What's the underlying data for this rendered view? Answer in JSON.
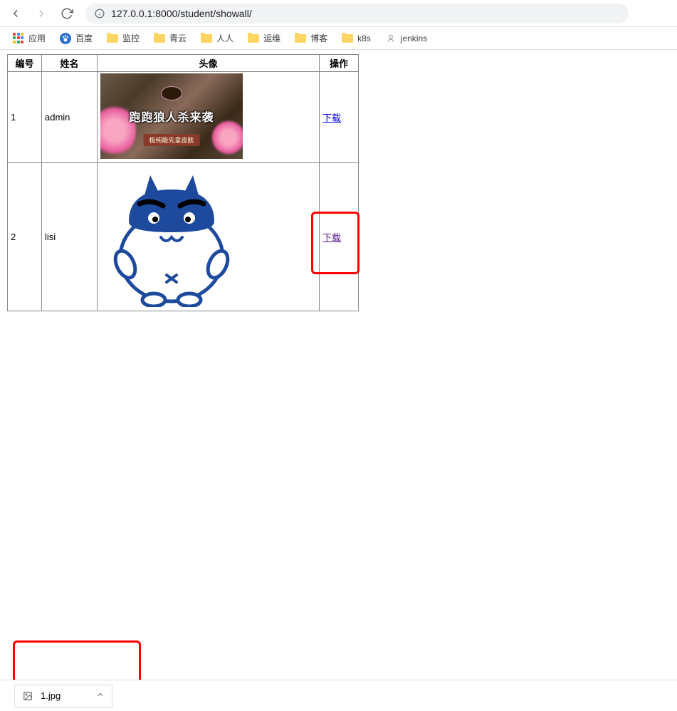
{
  "toolbar": {
    "url": "127.0.0.1:8000/student/showall/"
  },
  "bookmarks": {
    "apps": "应用",
    "baidu": "百度",
    "items": [
      {
        "label": "监控"
      },
      {
        "label": "青云"
      },
      {
        "label": "人人"
      },
      {
        "label": "运维"
      },
      {
        "label": "博客"
      },
      {
        "label": "k8s"
      }
    ],
    "jenkins": "jenkins"
  },
  "table": {
    "headers": {
      "id": "编号",
      "name": "姓名",
      "avatar": "头像",
      "action": "操作"
    },
    "rows": [
      {
        "id": "1",
        "name": "admin",
        "action": "下载",
        "banner_text": "跑跑狼人杀来袭",
        "sub_text": "极纯能先拿皮肤"
      },
      {
        "id": "2",
        "name": "lisi",
        "action": "下载"
      }
    ]
  },
  "download": {
    "filename": "1.jpg"
  }
}
